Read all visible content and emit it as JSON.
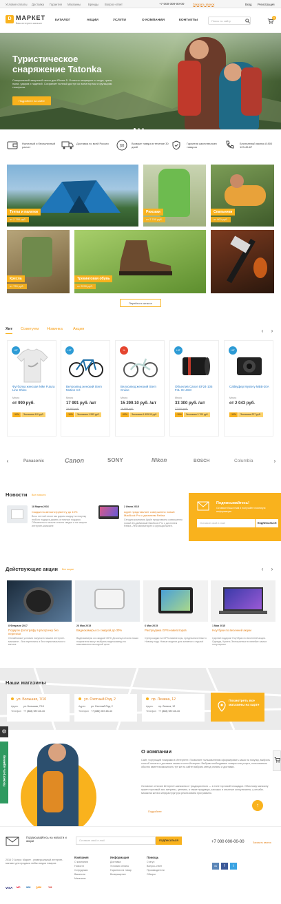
{
  "topbar": {
    "links": [
      "Условия оплаты",
      "Доставка",
      "Гарантия",
      "Магазины",
      "Бренды",
      "Вопрос-ответ"
    ],
    "phone": "+7 000 000-00-00",
    "callback": "Заказать звонок",
    "login": "Вход",
    "register": "Регистрация"
  },
  "header": {
    "logo_letter": "D",
    "logo_title": "МАРКЕТ",
    "logo_sub": "Ваш интернет-магазин",
    "nav": [
      "КАТАЛОГ",
      "АКЦИИ",
      "УСЛУГИ",
      "О КОМПАНИИ",
      "КОНТАКТЫ"
    ],
    "search_placeholder": "Поиск по сайту",
    "cart_count": "0"
  },
  "hero": {
    "title": "Туристическое снаряжение Tatonka",
    "text": "Специальный защитный чехол для iPhone 5. Отлично защищает от воды, грязи, пыли, ударов и падений. Сохраняет полный доступ ко всем портам и функциям телефона.",
    "button": "Подробнее на сайте"
  },
  "features": [
    "Наличный и безналичный расчет",
    "Доставка по всей России",
    "Возврат товара в течение 30 дней",
    "Гарантия качества всех товаров",
    "Бесплатный звонок 8 800 123-45-67"
  ],
  "feature_icon_30": "30",
  "categories": [
    {
      "label": "Тенты и палатки",
      "price": "от 2 790 руб."
    },
    {
      "label": "Рюкзаки",
      "price": "от 2 700 руб."
    },
    {
      "label": "Спальники",
      "price": "от 900 руб."
    },
    {
      "label": "Кресла",
      "price": "от 730 руб."
    },
    {
      "label": "Трекинговая обувь",
      "price": "от 2290 руб."
    },
    {
      "label": "",
      "price": ""
    }
  ],
  "all_categories_button": "Перейти в каталог",
  "product_tabs": [
    "Хит",
    "Советуем",
    "Новинка",
    "Акция"
  ],
  "products": [
    {
      "badge": "HIT",
      "name": "Футболка женская Nike Futura Line Shine",
      "stock": "Много",
      "price": "от 990 руб.",
      "old": "",
      "disc": "-10%",
      "save": "Экономия 110 руб."
    },
    {
      "badge": "HIT",
      "name": "Велосипед женский Stern Motion 4.0",
      "stock": "Много",
      "price": "17 991 руб. /шт",
      "old": "19 990 руб.",
      "disc": "-10%",
      "save": "Экономия 1 999 руб."
    },
    {
      "badge": "%",
      "name": "Велосипед женский Stern Cruise",
      "stock": "Много",
      "price": "15 299.10 руб. /шт",
      "old": "16 999 руб.",
      "disc": "-10%",
      "save": "Экономия 1 699.90 руб."
    },
    {
      "badge": "HIT",
      "name": "Объектив Canon EF24-105 F4L IS USM",
      "stock": "Много",
      "price": "33 300 руб. /шт",
      "old": "37 000 руб.",
      "disc": "-10%",
      "save": "Экономия 3 700 руб."
    },
    {
      "badge": "HIT",
      "name": "Сабвуфер Mystery MBB-20A",
      "stock": "Много",
      "price": "от 2 043 руб.",
      "old": "",
      "disc": "-10%",
      "save": "Экономия 227 руб."
    }
  ],
  "brands": [
    "Panasonic",
    "Canon",
    "SONY",
    "Nikon",
    "BOSCH",
    "Columbia"
  ],
  "news": {
    "title": "Новости",
    "all": "Все новости",
    "items": [
      {
        "date": "18 Марта 2016",
        "title": "Скидки на автоинструменту до 10%",
        "desc": "Весь летний сезон мы дарим скидку на покупку любого подарка давать отличные подарки. Объявлено в начале сезона скидки и на защите интернет-магазине"
      },
      {
        "date": "2 Июня 2015",
        "title": "Apple представляет совершенно новый MacBook Pro с дисплеем Retina",
        "desc": "Сегодня компания Apple представила совершенно новый 15-дюймовый MacBook Pro с дисплеем Retina. Лёгк миниатюрен и функционален."
      }
    ]
  },
  "subscribe": {
    "title": "Подписывайтесь!",
    "text": "Оставьте Ваш email и получайте полезную информацию",
    "placeholder": "Оставьте свой e-mail",
    "button": "ПОДПИСАТЬСЯ"
  },
  "promos": {
    "title": "Действующие акции",
    "all": "Все акции",
    "items": [
      {
        "date": "8 Февраля 2017",
        "title": "Подарок фотографу в рассрочку без переплат",
        "desc": "Онлайновые условия покупки в нашем интернет-магазине - без переплаты и без первоначального взноса."
      },
      {
        "date": "26 Мая 2015",
        "title": "Видеокамеры со скидкой до 30%",
        "desc": "Видеокамеры со скидкой 30%! До конца сезона наши покупатели могут выбрать видеокамеру по максимально выгодной цене."
      },
      {
        "date": "6 Мая 2015",
        "title": "Распродажа GPS-навигаторов",
        "desc": "Суперскидки на GPS-навигаторы, предназначенные к Новому году. Новые модели для активного отдыха!"
      },
      {
        "date": "1 Мая 2015",
        "title": "Ноутбуки по весенней акции",
        "desc": "Сделай подарок! Ноутбуки по весенней акции. Одежда, Купить Электронные в линейке самых популярных"
      }
    ]
  },
  "stores": {
    "title": "Наши магазины",
    "items": [
      {
        "name": "ул. Большая, 7/10",
        "addr": "ул. Большая, 7/10",
        "phone": "+7 (888) 987-65-43"
      },
      {
        "name": "ул. Охотный Ряд, 2",
        "addr": "ул. Охотный Ряд, 2",
        "phone": "+7 (888) 987-65-43"
      },
      {
        "name": "пр. Ленина, 12",
        "addr": "пр. Ленина, 12",
        "phone": "+7 (888) 987-65-43"
      }
    ],
    "addr_label": "Адрес",
    "phone_label": "Телефон",
    "all": "Посмотреть все магазины на карте"
  },
  "about": {
    "title": "О компании",
    "p1": "Сайт, торгующий товарами в Интернете. Позволяет пользователям сформировать заказ на покупку, выбрать способ оплаты и доставки заказа в сети Интернет. Выбрав необходимые товары или услуги, пользователь обычно имеет возможность тут же на сайте выбрать метод оплаты и доставки.",
    "p2": "Основное отличие Интернет-магазина от традиционного — в типе торговой площадки. Обычному магазину нужен торговый зал, витрины, ценники, а также продавцы, кассиры и опытные консультанты, у онлайн-магазина же вся инфраструктура реализована программно.",
    "more": "Подробнее"
  },
  "side_tab": "Посмотреть админку",
  "footer": {
    "sub_title": "Подписывайтесь на новости и акции",
    "placeholder": "Оставьте свой e-mail",
    "button": "ПОДПИСАТЬСЯ",
    "phone": "+7 000 000-00-00",
    "callback": "Заказать звонок",
    "copy": "2016 © Аспро: Маркет - универсальный интернет-магазин для продажи любых видов товаров.",
    "cols": [
      {
        "title": "Компания",
        "items": [
          "О компании",
          "Новости",
          "Сотрудники",
          "Вакансии",
          "Магазины"
        ]
      },
      {
        "title": "Информация",
        "items": [
          "Доставка",
          "Условия оплаты",
          "Гарантия на товар",
          "Возвращение"
        ]
      },
      {
        "title": "Помощь",
        "items": [
          "Статус",
          "Вопрос-ответ",
          "Производители",
          "Обзоры"
        ]
      }
    ],
    "pay": [
      "VISA",
      "MC",
      "WM",
      "QIWI",
      "YM"
    ],
    "social": [
      "vk",
      "f",
      "t"
    ]
  },
  "colors": {
    "accent": "#f9b21d",
    "link": "#2a7cc7",
    "orange_text": "#e4811a",
    "green_tab": "#2f9a60"
  }
}
